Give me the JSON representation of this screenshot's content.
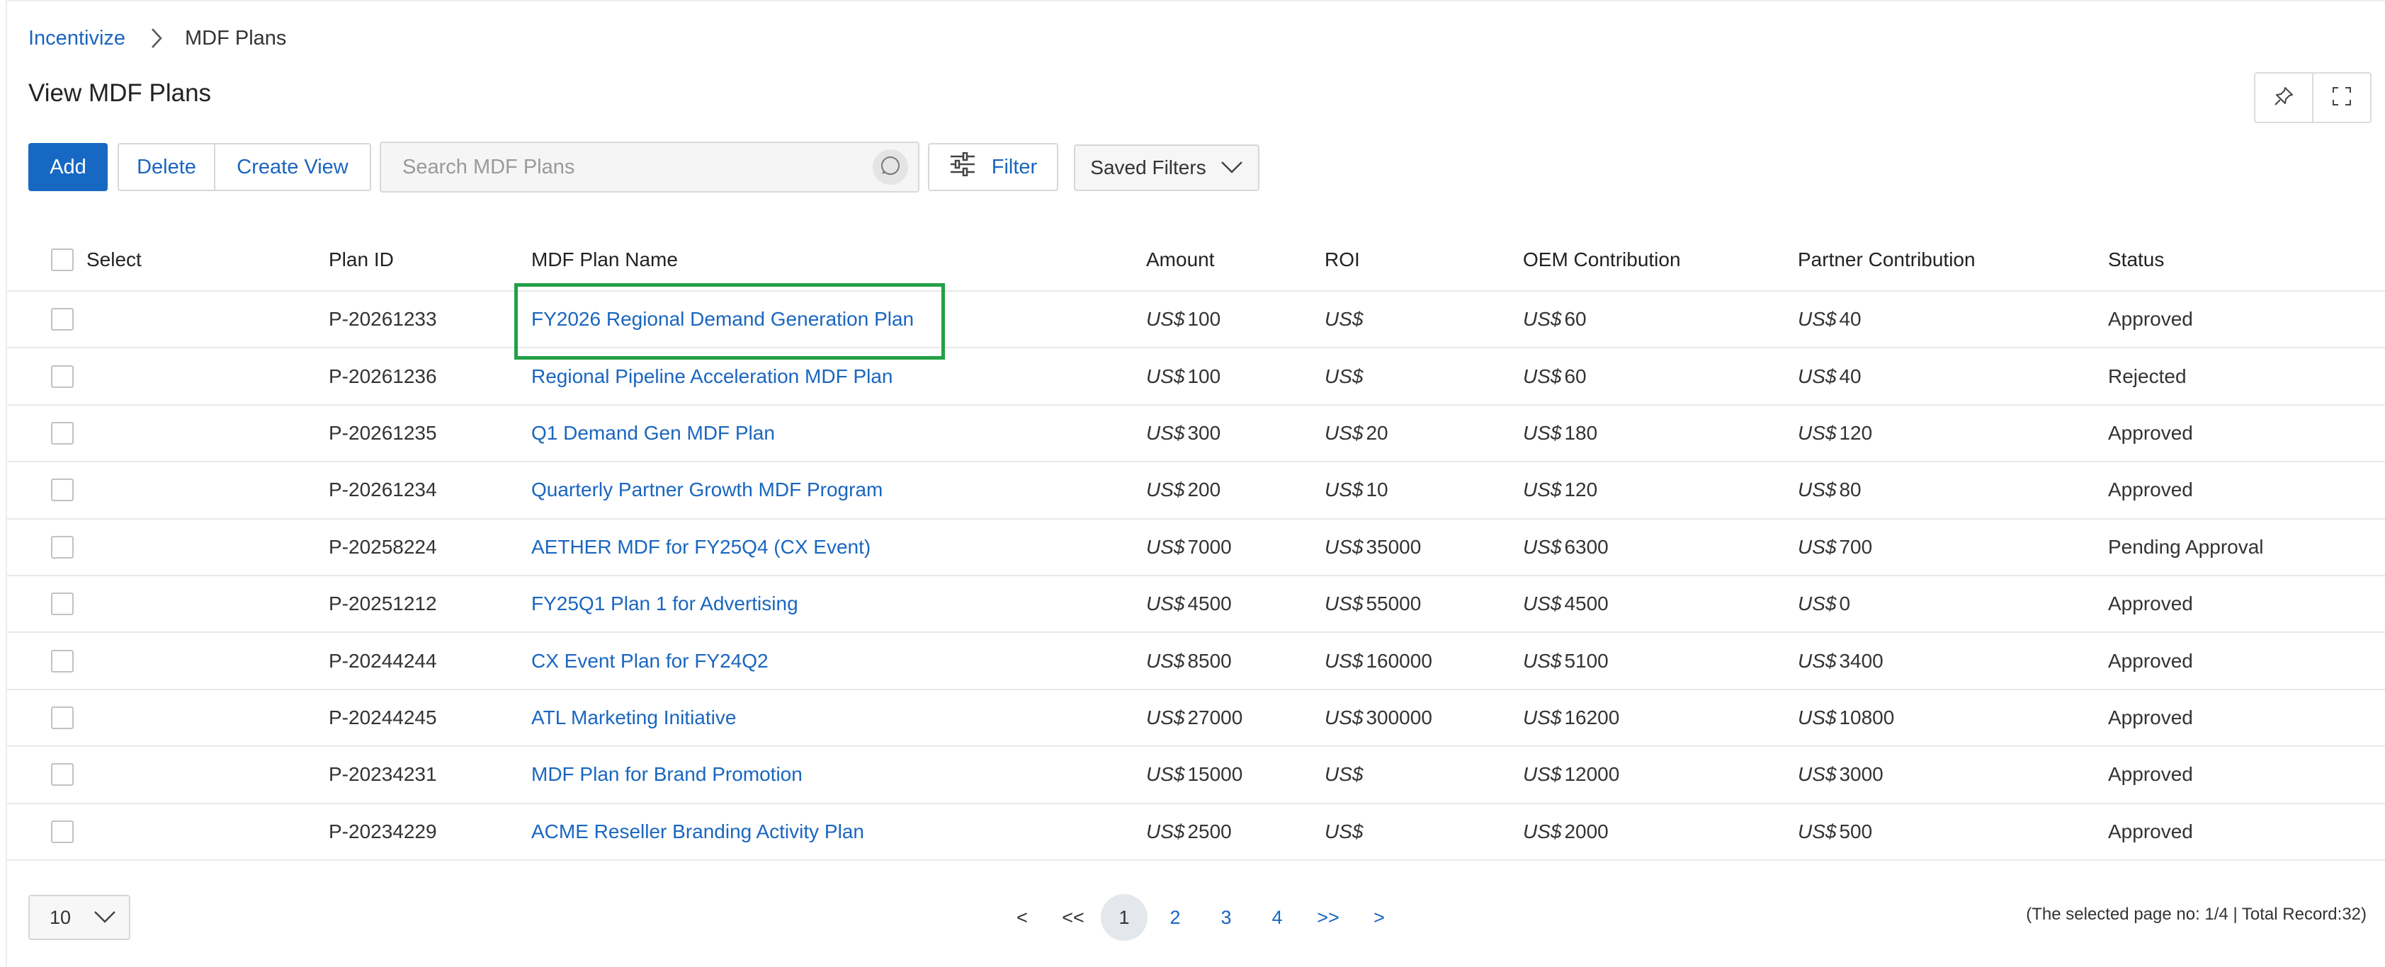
{
  "breadcrumb": {
    "root": "Incentivize",
    "current": "MDF Plans"
  },
  "page_title": "View MDF Plans",
  "toolbar": {
    "add_label": "Add",
    "delete_label": "Delete",
    "create_view_label": "Create View",
    "search_placeholder": "Search MDF Plans",
    "filter_label": "Filter",
    "saved_filters_label": "Saved Filters"
  },
  "table": {
    "headers": {
      "select": "Select",
      "plan_id": "Plan ID",
      "name": "MDF Plan Name",
      "amount": "Amount",
      "roi": "ROI",
      "oem": "OEM Contribution",
      "partner": "Partner Contribution",
      "status": "Status"
    },
    "currency": "US$",
    "rows": [
      {
        "plan_id": "P-20261233",
        "name": "FY2026 Regional Demand Generation Plan",
        "amount": "100",
        "roi": "",
        "oem": "60",
        "partner": "40",
        "status": "Approved"
      },
      {
        "plan_id": "P-20261236",
        "name": "Regional Pipeline Acceleration MDF Plan",
        "amount": "100",
        "roi": "",
        "oem": "60",
        "partner": "40",
        "status": "Rejected"
      },
      {
        "plan_id": "P-20261235",
        "name": "Q1 Demand Gen MDF Plan",
        "amount": "300",
        "roi": "20",
        "oem": "180",
        "partner": "120",
        "status": "Approved"
      },
      {
        "plan_id": "P-20261234",
        "name": "Quarterly Partner Growth MDF Program",
        "amount": "200",
        "roi": "10",
        "oem": "120",
        "partner": "80",
        "status": "Approved"
      },
      {
        "plan_id": "P-20258224",
        "name": "AETHER MDF for FY25Q4 (CX Event)",
        "amount": "7000",
        "roi": "35000",
        "oem": "6300",
        "partner": "700",
        "status": "Pending Approval"
      },
      {
        "plan_id": "P-20251212",
        "name": "FY25Q1 Plan 1 for Advertising",
        "amount": "4500",
        "roi": "55000",
        "oem": "4500",
        "partner": "0",
        "status": "Approved"
      },
      {
        "plan_id": "P-20244244",
        "name": "CX Event Plan for FY24Q2",
        "amount": "8500",
        "roi": "160000",
        "oem": "5100",
        "partner": "3400",
        "status": "Approved"
      },
      {
        "plan_id": "P-20244245",
        "name": "ATL Marketing Initiative",
        "amount": "27000",
        "roi": "300000",
        "oem": "16200",
        "partner": "10800",
        "status": "Approved"
      },
      {
        "plan_id": "P-20234231",
        "name": "MDF Plan for Brand Promotion",
        "amount": "15000",
        "roi": "",
        "oem": "12000",
        "partner": "3000",
        "status": "Approved"
      },
      {
        "plan_id": "P-20234229",
        "name": "ACME Reseller Branding Activity Plan",
        "amount": "2500",
        "roi": "",
        "oem": "2000",
        "partner": "500",
        "status": "Approved"
      }
    ]
  },
  "pagination": {
    "page_size": "10",
    "prev": "<",
    "first": "<<",
    "pages": [
      "1",
      "2",
      "3",
      "4"
    ],
    "active_page": "1",
    "last": ">>",
    "next": ">",
    "info": "(The selected page no: 1/4 | Total Record:32)"
  },
  "colors": {
    "accent": "#1768c2",
    "link": "#1a66bf",
    "highlight": "#22a046"
  }
}
